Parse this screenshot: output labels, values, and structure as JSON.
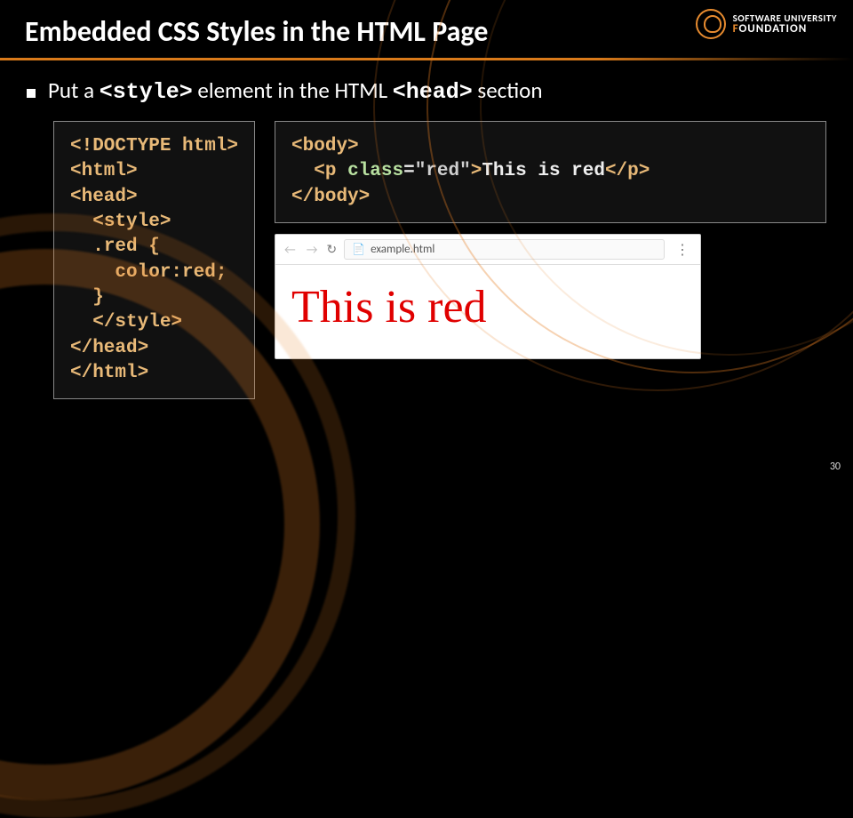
{
  "logo": {
    "line1": "SOFTWARE UNIVERSITY",
    "line2_a": "F",
    "line2_b": "OUNDATION"
  },
  "title": "Embedded CSS Styles in the HTML Page",
  "bullet": {
    "t1": "Put a ",
    "code1": "<style>",
    "t2": " element in the HTML ",
    "code2": "<head>",
    "t3": " section"
  },
  "code_left": "<!DOCTYPE html>\n<html>\n<head>\n  <style>\n  .red {\n    color:red;\n  }\n  </style>\n</head>\n</html>",
  "code_right": "<body>\n  <p class=\"red\">This is red</p>\n</body>",
  "browser": {
    "url": "example.html",
    "rendered_text": "This is red"
  },
  "page_number": "30"
}
